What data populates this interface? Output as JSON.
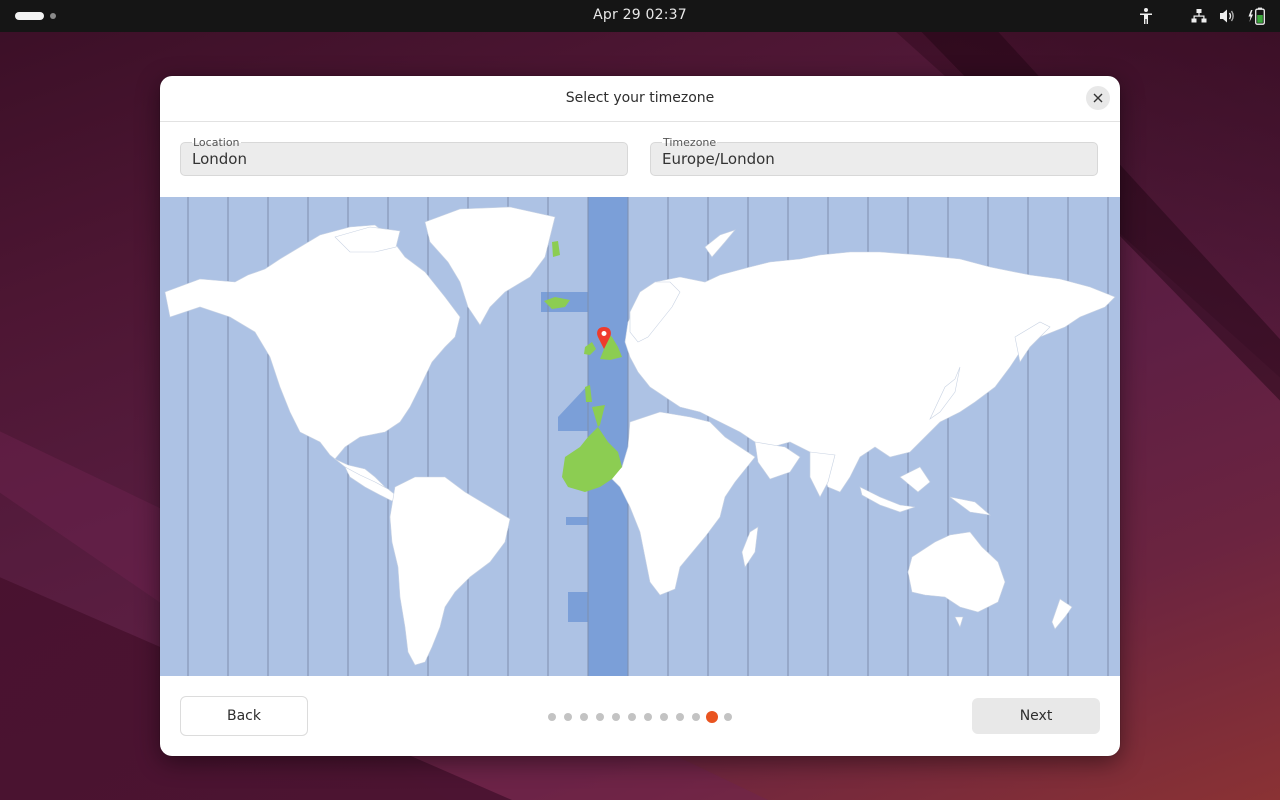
{
  "topbar": {
    "clock": "Apr 29  02:37",
    "workspaces": [
      {
        "active": true
      },
      {
        "active": false
      }
    ],
    "tray_icons": [
      "accessibility-icon",
      "network-icon",
      "volume-icon",
      "battery-charging-icon"
    ]
  },
  "dialog": {
    "title": "Select your timezone",
    "close_icon": "close-icon",
    "location": {
      "label": "Location",
      "value": "London"
    },
    "timezone": {
      "label": "Timezone",
      "value": "Europe/London"
    },
    "map": {
      "selected_timezone": "Europe/London",
      "selected_city": "London",
      "colors": {
        "ocean": "#adc2e4",
        "highlight_band": "#7b9fd8",
        "selected_land": "#8ccd52",
        "land": "#ffffff",
        "pin": "#ef3b2d"
      }
    },
    "back_label": "Back",
    "next_label": "Next",
    "pager": {
      "total": 12,
      "current": 11
    }
  },
  "colors": {
    "accent": "#e95420",
    "topbar_bg": "#151515"
  }
}
